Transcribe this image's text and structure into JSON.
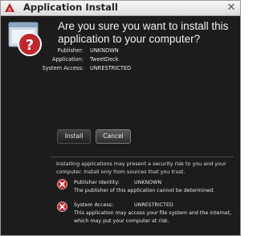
{
  "window": {
    "title": "Application Install",
    "close_glyph": "✕"
  },
  "dialog": {
    "headline": "Are you sure you want to install this application to your computer?",
    "details": [
      {
        "label": "Publisher:",
        "value": "UNKNOWN"
      },
      {
        "label": "Application:",
        "value": "TweetDeck"
      },
      {
        "label": "System Access:",
        "value": "UNRESTRICTED"
      }
    ],
    "buttons": {
      "install": "Install",
      "cancel": "Cancel"
    },
    "warning": "Installing applications may present a security risk to you and your computer. Install only from sources that you trust.",
    "risks": [
      {
        "icon": "error-x-icon",
        "label": "Publisher Identity:",
        "value": "UNKNOWN",
        "description": "The publisher of this application cannot be determined."
      },
      {
        "icon": "error-x-icon",
        "label": "System Access:",
        "value": "UNRESTRICTED",
        "description_lines": [
          "This application may access your file system and the internet,",
          "which may put your computer at risk."
        ]
      }
    ]
  },
  "colors": {
    "background": "#1c1c1c",
    "alert_red": "#c0282d",
    "text": "#f2f2f2"
  }
}
